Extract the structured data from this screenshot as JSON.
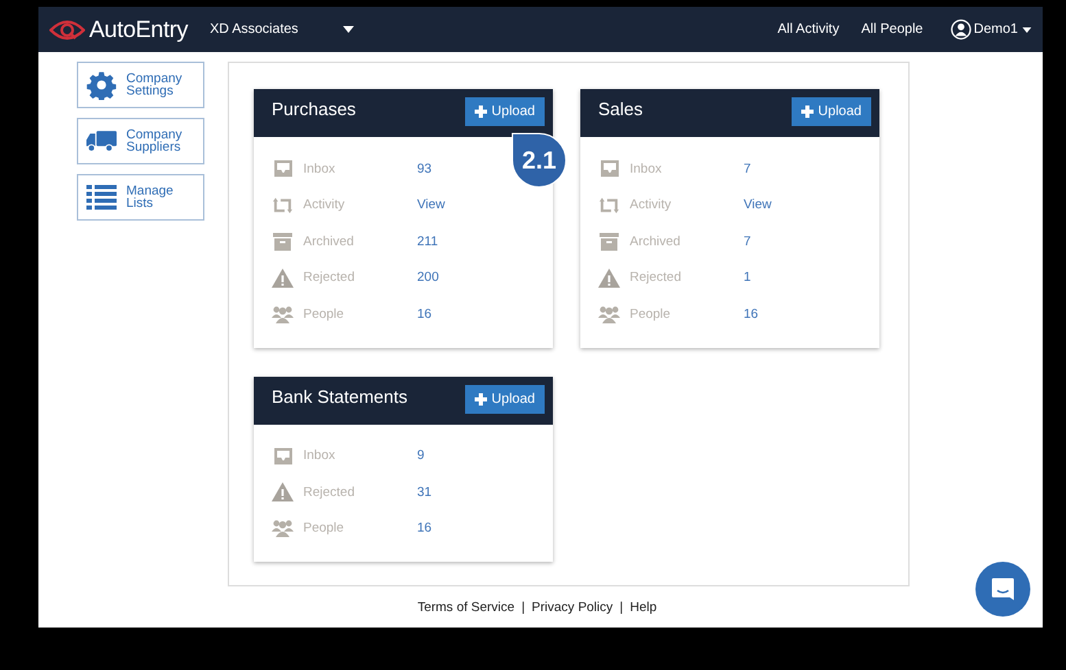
{
  "navbar": {
    "logo": "AutoEntry",
    "company": "XD Associates",
    "links": [
      "All Activity",
      "All People"
    ],
    "user": "Demo1"
  },
  "sidebar": [
    {
      "kind": "settings",
      "label": "Company Settings"
    },
    {
      "kind": "suppliers",
      "label": "Company Suppliers"
    },
    {
      "kind": "lists",
      "label": "Manage Lists"
    }
  ],
  "cards": [
    {
      "title": "Purchases",
      "button": "Upload",
      "callout": "2.1",
      "rows": [
        {
          "kind": "inbox",
          "label": "Inbox",
          "value": "93"
        },
        {
          "kind": "activity",
          "label": "Activity",
          "value": "View"
        },
        {
          "kind": "archived",
          "label": "Archived",
          "value": "211"
        },
        {
          "kind": "rejected",
          "label": "Rejected",
          "value": "200"
        },
        {
          "kind": "people",
          "label": "People",
          "value": "16"
        }
      ]
    },
    {
      "title": "Sales",
      "button": "Upload",
      "rows": [
        {
          "kind": "inbox",
          "label": "Inbox",
          "value": "7"
        },
        {
          "kind": "activity",
          "label": "Activity",
          "value": "View"
        },
        {
          "kind": "archived",
          "label": "Archived",
          "value": "7"
        },
        {
          "kind": "rejected",
          "label": "Rejected",
          "value": "1"
        },
        {
          "kind": "people",
          "label": "People",
          "value": "16"
        }
      ]
    },
    {
      "title": "Bank Statements",
      "button": "Upload",
      "rows": [
        {
          "kind": "inbox",
          "label": "Inbox",
          "value": "9"
        },
        {
          "kind": "rejected",
          "label": "Rejected",
          "value": "31"
        },
        {
          "kind": "people",
          "label": "People",
          "value": "16"
        }
      ]
    }
  ],
  "footer": {
    "links": [
      "Terms of Service",
      "Privacy Policy",
      "Help"
    ],
    "separator": "|"
  }
}
